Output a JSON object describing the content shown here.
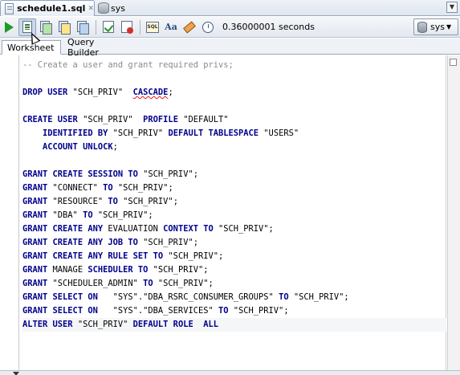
{
  "tabs": {
    "active_file": "schedule1.sql",
    "second": "sys"
  },
  "toolbar": {
    "elapsed": "0.36000001 seconds",
    "connection": "sys",
    "sql_icon_text": "SQL",
    "case_icon_text": "Aa"
  },
  "subtabs": {
    "worksheet": "Worksheet",
    "query_builder": "Query Builder"
  },
  "editor": {
    "lines": [
      [
        {
          "t": "-- Create a user and grant required privs;",
          "c": "cm"
        }
      ],
      [],
      [
        {
          "t": "DROP USER",
          "c": "kw"
        },
        {
          "t": " \"SCH_PRIV\"  ",
          "c": "",
          "e": false
        },
        {
          "t": "CASCADE",
          "c": "kw",
          "e": true
        },
        {
          "t": ";",
          "c": ""
        }
      ],
      [],
      [
        {
          "t": "CREATE USER",
          "c": "kw"
        },
        {
          "t": " \"SCH_PRIV\"  ",
          "c": ""
        },
        {
          "t": "PROFILE",
          "c": "kw"
        },
        {
          "t": " \"DEFAULT\"",
          "c": ""
        }
      ],
      [
        {
          "t": "    IDENTIFIED BY",
          "c": "kw"
        },
        {
          "t": " \"SCH_PRIV\" ",
          "c": ""
        },
        {
          "t": "DEFAULT TABLESPACE",
          "c": "kw"
        },
        {
          "t": " \"USERS\"",
          "c": ""
        }
      ],
      [
        {
          "t": "    ACCOUNT UNLOCK",
          "c": "kw"
        },
        {
          "t": ";",
          "c": ""
        }
      ],
      [],
      [
        {
          "t": "GRANT CREATE SESSION TO",
          "c": "kw"
        },
        {
          "t": " \"SCH_PRIV\";",
          "c": ""
        }
      ],
      [
        {
          "t": "GRANT",
          "c": "kw"
        },
        {
          "t": " \"CONNECT\" ",
          "c": ""
        },
        {
          "t": "TO",
          "c": "kw"
        },
        {
          "t": " \"SCH_PRIV\";",
          "c": ""
        }
      ],
      [
        {
          "t": "GRANT",
          "c": "kw"
        },
        {
          "t": " \"RESOURCE\" ",
          "c": ""
        },
        {
          "t": "TO",
          "c": "kw"
        },
        {
          "t": " \"SCH_PRIV\";",
          "c": ""
        }
      ],
      [
        {
          "t": "GRANT",
          "c": "kw"
        },
        {
          "t": " \"DBA\" ",
          "c": ""
        },
        {
          "t": "TO",
          "c": "kw"
        },
        {
          "t": " \"SCH_PRIV\";",
          "c": ""
        }
      ],
      [
        {
          "t": "GRANT CREATE ANY",
          "c": "kw"
        },
        {
          "t": " EVALUATION ",
          "c": ""
        },
        {
          "t": "CONTEXT TO",
          "c": "kw"
        },
        {
          "t": " \"SCH_PRIV\";",
          "c": ""
        }
      ],
      [
        {
          "t": "GRANT CREATE ANY JOB TO",
          "c": "kw"
        },
        {
          "t": " \"SCH_PRIV\";",
          "c": ""
        }
      ],
      [
        {
          "t": "GRANT CREATE ANY RULE SET TO",
          "c": "kw"
        },
        {
          "t": " \"SCH_PRIV\";",
          "c": ""
        }
      ],
      [
        {
          "t": "GRANT",
          "c": "kw"
        },
        {
          "t": " MANAGE ",
          "c": ""
        },
        {
          "t": "SCHEDULER TO",
          "c": "kw"
        },
        {
          "t": " \"SCH_PRIV\";",
          "c": ""
        }
      ],
      [
        {
          "t": "GRANT",
          "c": "kw"
        },
        {
          "t": " \"SCHEDULER_ADMIN\" ",
          "c": ""
        },
        {
          "t": "TO",
          "c": "kw"
        },
        {
          "t": " \"SCH_PRIV\";",
          "c": ""
        }
      ],
      [
        {
          "t": "GRANT SELECT ON",
          "c": "kw"
        },
        {
          "t": "   \"SYS\".\"DBA_RSRC_CONSUMER_GROUPS\" ",
          "c": ""
        },
        {
          "t": "TO",
          "c": "kw"
        },
        {
          "t": " \"SCH_PRIV\";",
          "c": ""
        }
      ],
      [
        {
          "t": "GRANT SELECT ON",
          "c": "kw"
        },
        {
          "t": "   \"SYS\".\"DBA_SERVICES\" ",
          "c": ""
        },
        {
          "t": "TO",
          "c": "kw"
        },
        {
          "t": " \"SCH_PRIV\";",
          "c": ""
        }
      ],
      [
        {
          "t": "ALTER USER",
          "c": "kw"
        },
        {
          "t": " \"SCH_PRIV\" ",
          "c": ""
        },
        {
          "t": "DEFAULT ROLE",
          "c": "kw"
        },
        {
          "t": "  ",
          "c": ""
        },
        {
          "t": "ALL",
          "c": "kw"
        }
      ]
    ],
    "current_line": 19
  }
}
